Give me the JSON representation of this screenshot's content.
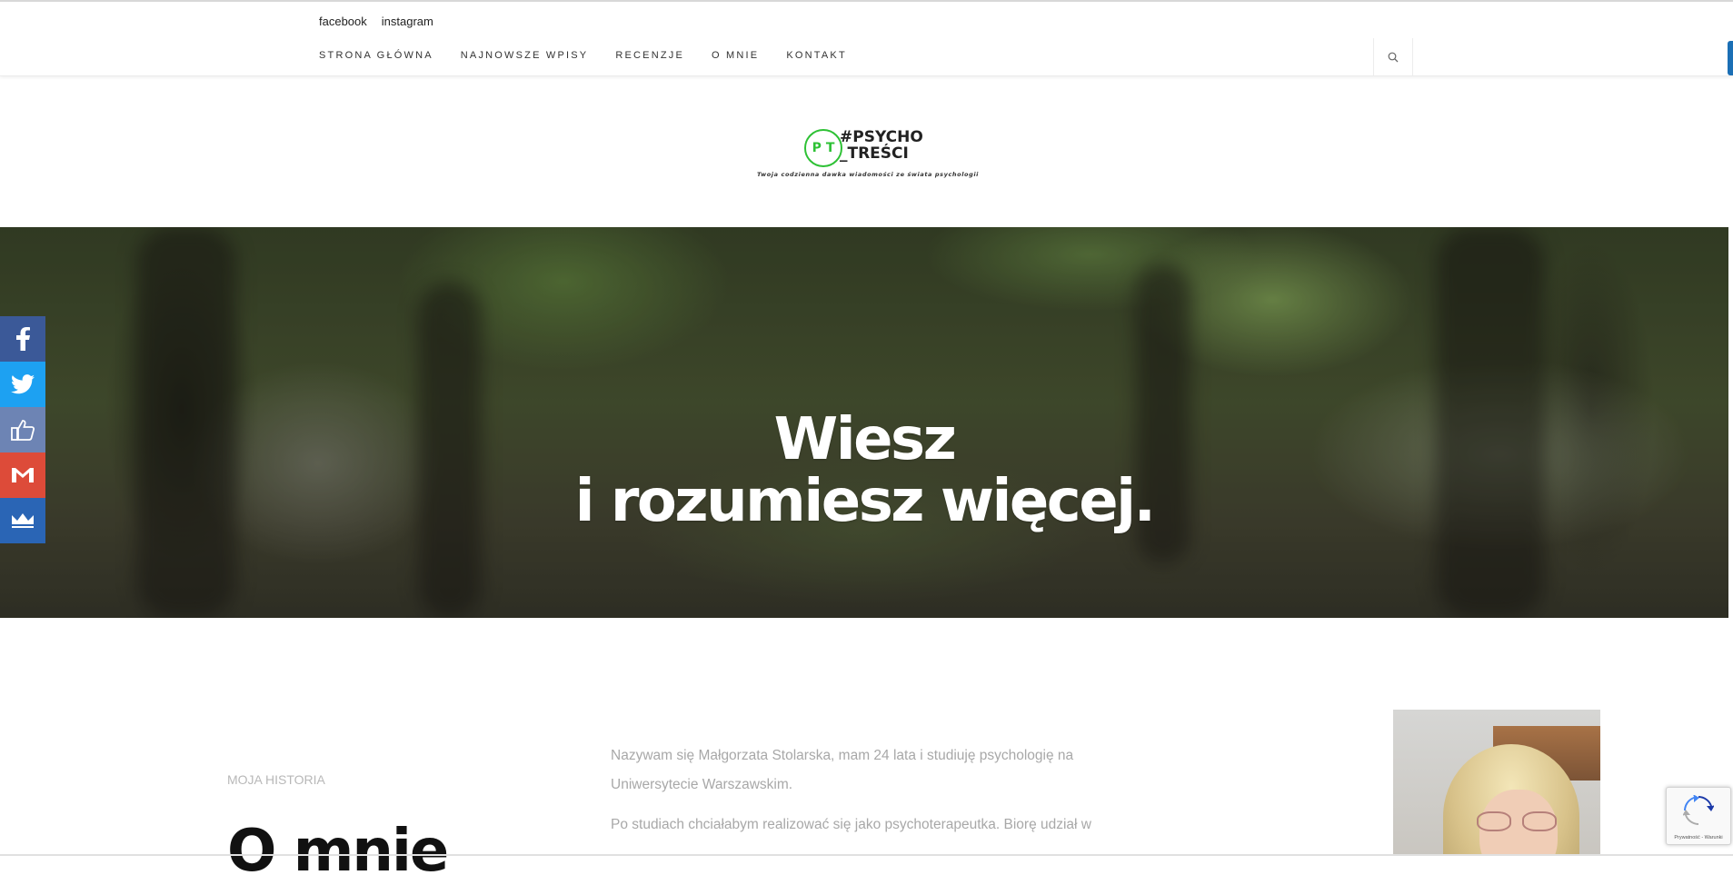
{
  "topbar": {
    "links": [
      {
        "label": "facebook"
      },
      {
        "label": "instagram"
      }
    ]
  },
  "nav": {
    "items": [
      {
        "label": "STRONA GŁÓWNA"
      },
      {
        "label": "NAJNOWSZE WPISY"
      },
      {
        "label": "RECENZJE"
      },
      {
        "label": "O MNIE"
      },
      {
        "label": "KONTAKT"
      }
    ],
    "search_icon": "search-icon"
  },
  "logo": {
    "initials": "PT",
    "line1": "#PSYCHO",
    "line2": "_TREŚCI",
    "tagline": "Twoja codzienna dawka wiadomości ze świata psychologii"
  },
  "hero": {
    "line1": "Wiesz",
    "line2": "i rozumiesz więcej."
  },
  "share": {
    "buttons": [
      {
        "icon": "facebook-icon",
        "color": "#3b5998"
      },
      {
        "icon": "twitter-icon",
        "color": "#1da1f2"
      },
      {
        "icon": "like-icon",
        "color": "#6d84b4"
      },
      {
        "icon": "gmail-icon",
        "color": "#dd4b39"
      },
      {
        "icon": "crown-icon",
        "color": "#2a65b5"
      }
    ]
  },
  "about": {
    "label": "MOJA HISTORIA",
    "heading": "O mnie",
    "paragraphs": [
      "Nazywam się Małgorzata Stolarska, mam 24 lata i studiuję psychologię na Uniwersytecie Warszawskim.",
      "Po studiach chciałabym realizować się jako psychoterapeutka. Biorę udział w"
    ]
  },
  "recaptcha": {
    "text": "Prywatność - Warunki"
  },
  "colors": {
    "accent_green": "#2ec135",
    "scroll_blue": "#1b6fb5"
  }
}
